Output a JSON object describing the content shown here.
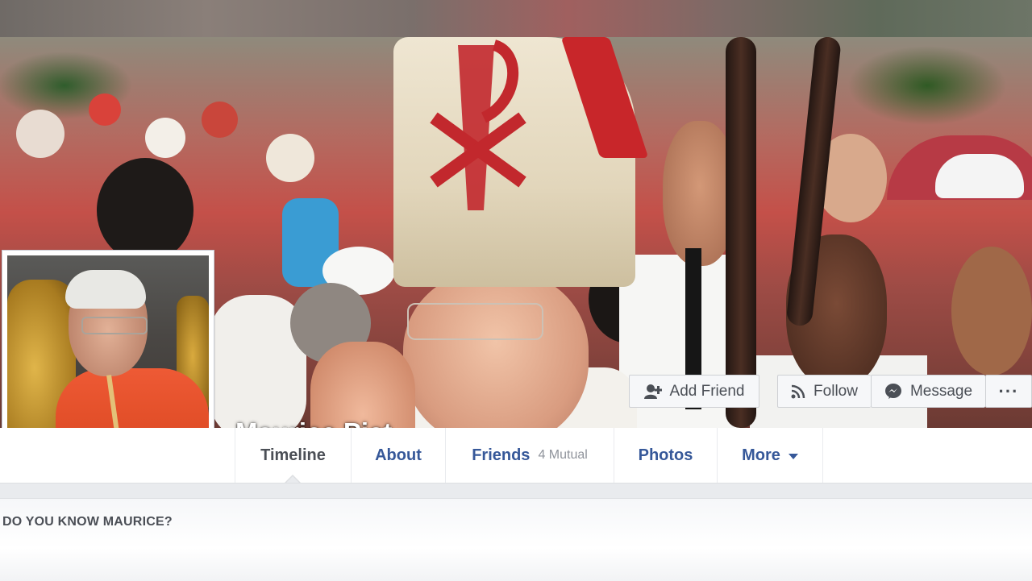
{
  "profile": {
    "name": "Maurice Piat"
  },
  "actions": {
    "add_friend": "Add Friend",
    "follow": "Follow",
    "message": "Message",
    "more_dots": "···"
  },
  "tabs": [
    {
      "label": "Timeline",
      "active": true
    },
    {
      "label": "About"
    },
    {
      "label": "Friends",
      "sub": "4 Mutual"
    },
    {
      "label": "Photos"
    },
    {
      "label": "More"
    }
  ],
  "prompt": {
    "title": "DO YOU KNOW MAURICE?"
  },
  "icons": {
    "add_friend": "add-friend-icon",
    "follow": "rss-icon",
    "message": "messenger-icon",
    "more": "caret-down-icon"
  },
  "colors": {
    "link": "#365899",
    "text": "#4b4f56",
    "muted": "#90949c",
    "page_bg": "#e9ebee"
  }
}
